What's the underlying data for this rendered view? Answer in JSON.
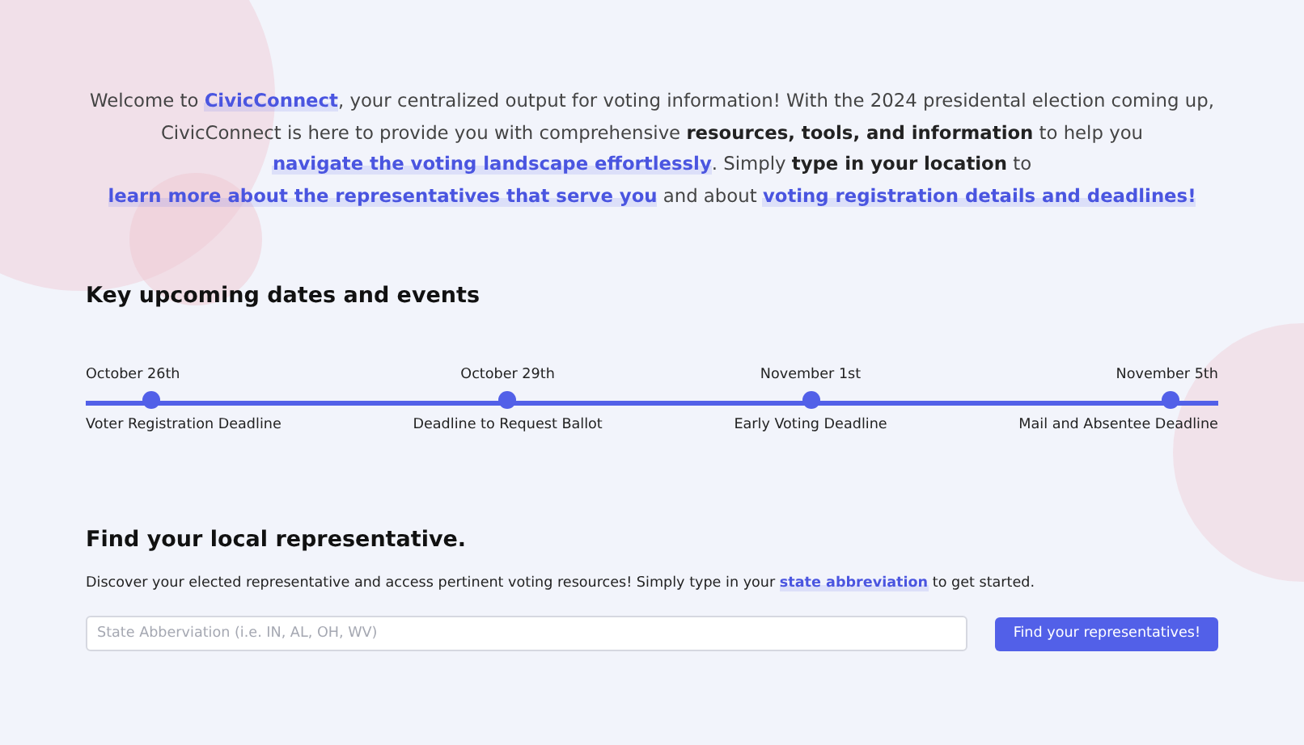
{
  "intro": [
    {
      "kind": "text",
      "text": "Welcome to "
    },
    {
      "kind": "link",
      "text": "CivicConnect"
    },
    {
      "kind": "text",
      "text": ", your centralized output for voting information! With the 2024 presidental election coming up, CivicConnect is here to provide you with comprehensive "
    },
    {
      "kind": "bold",
      "text": "resources, tools, and information"
    },
    {
      "kind": "text",
      "text": " to help you "
    },
    {
      "kind": "link",
      "text": "navigate the voting landscape effortlessly"
    },
    {
      "kind": "text",
      "text": ". Simply "
    },
    {
      "kind": "bold",
      "text": "type in your location"
    },
    {
      "kind": "text",
      "text": " to "
    },
    {
      "kind": "link",
      "text": "learn more about the representatives that serve you"
    },
    {
      "kind": "text",
      "text": " and about "
    },
    {
      "kind": "link",
      "text": "voting registration details and deadlines!"
    }
  ],
  "events_section": {
    "title": "Key upcoming dates and events",
    "events": [
      {
        "date": "October 26th",
        "label": "Voter Registration Deadline"
      },
      {
        "date": "October 29th",
        "label": "Deadline to Request Ballot"
      },
      {
        "date": "November 1st",
        "label": "Early Voting Deadline"
      },
      {
        "date": "November 5th",
        "label": "Mail and Absentee Deadline"
      }
    ]
  },
  "representative_section": {
    "title": "Find your local representative.",
    "description": [
      {
        "kind": "text",
        "text": "Discover your elected representative and access pertinent voting resources! Simply type in your "
      },
      {
        "kind": "link",
        "text": "state abbreviation"
      },
      {
        "kind": "text",
        "text": " to get started."
      }
    ],
    "search": {
      "placeholder": "State Abberviation (i.e. IN, AL, OH, WV)"
    },
    "button": "Find your representatives!"
  }
}
